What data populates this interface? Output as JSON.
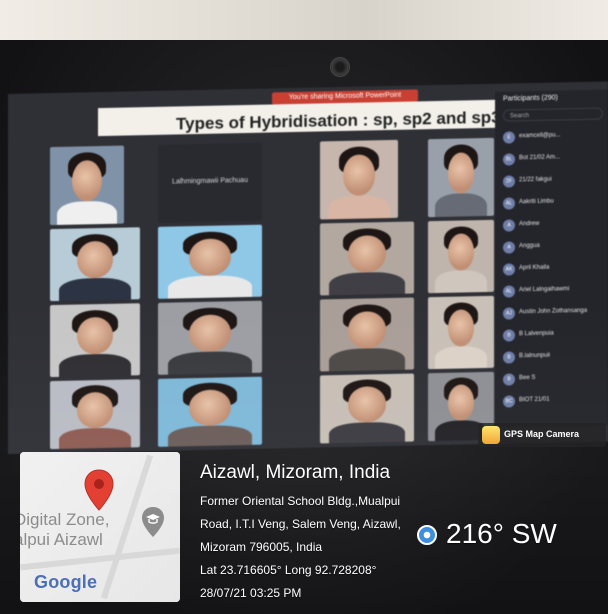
{
  "screen": {
    "share_banner": "You're sharing Microsoft PowerPoint",
    "slide_title": "Types of Hybridisation : sp, sp2 and sp3",
    "named_tile": "Lalhmingmawii Pachuau"
  },
  "participants": {
    "title": "Participants (290)",
    "search_placeholder": "Search",
    "items": [
      {
        "initials": "E",
        "name": "examcell@pu..."
      },
      {
        "initials": "BL",
        "name": "Bot 21/02 Am..."
      },
      {
        "initials": "2F",
        "name": "21/22 fakgui"
      },
      {
        "initials": "AL",
        "name": "Aakriti Limbu"
      },
      {
        "initials": "A",
        "name": "Andrew"
      },
      {
        "initials": "A",
        "name": "Anggua"
      },
      {
        "initials": "AK",
        "name": "April Khaila"
      },
      {
        "initials": "AL",
        "name": "Ariel Lalngaihawmi"
      },
      {
        "initials": "AJ",
        "name": "Austin John Zothansanga"
      },
      {
        "initials": "B",
        "name": "B Lalvenpuia"
      },
      {
        "initials": "B",
        "name": "B.lalnunpuii"
      },
      {
        "initials": "B",
        "name": "Bee S"
      },
      {
        "initials": "BC",
        "name": "BIOT 21/01"
      }
    ]
  },
  "map": {
    "place_line1": "Digital Zone,",
    "place_line2": "alpui Aizawl",
    "brand": "Google"
  },
  "location": {
    "title": "Aizawl, Mizoram, India",
    "address_line1": "Former Oriental School Bldg.,Mualpui",
    "address_line2": "Road, I.T.I Veng, Salem Veng, Aizawl,",
    "address_line3": "Mizoram 796005, India",
    "coords": "Lat 23.716605° Long 92.728208°",
    "datetime": "28/07/21 03:25 PM",
    "heading": "216° SW"
  },
  "badge": {
    "label": "GPS Map Camera"
  },
  "colors": {
    "banner": "#c94033",
    "pin": "#e23b2e",
    "compass": "#3b8de0"
  }
}
